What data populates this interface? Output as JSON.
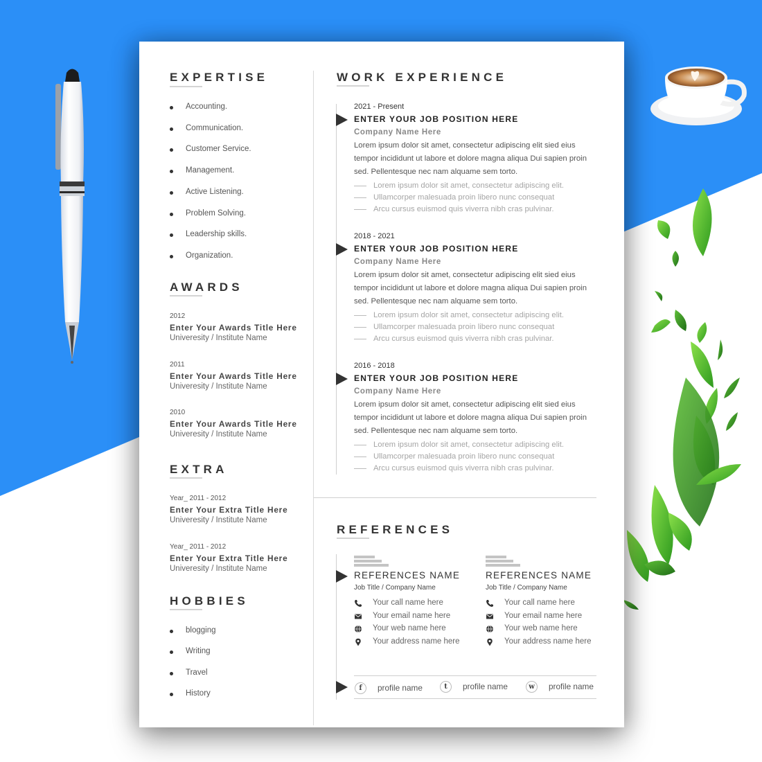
{
  "colors": {
    "background_blue": "#2b8ff7",
    "background_white": "#ffffff",
    "heading": "#333333",
    "accent_arrow": "#333333"
  },
  "decorations": {
    "pen": "white-ballpoint-pen-icon",
    "coffee": "latte-coffee-cup-icon",
    "leaves": "green-leaves-icon"
  },
  "expertise": {
    "title": "EXPERTISE",
    "items": [
      "Accounting.",
      "Communication.",
      "Customer Service.",
      "Management.",
      "Active Listening.",
      "Problem Solving.",
      "Leadership skills.",
      "Organization."
    ]
  },
  "awards": {
    "title": "AWARDS",
    "items": [
      {
        "year": "2012",
        "title": "Enter Your Awards Title Here",
        "institute": "Univeresity / Institute Name"
      },
      {
        "year": "2011",
        "title": "Enter Your Awards Title Here",
        "institute": "Univeresity / Institute Name"
      },
      {
        "year": "2010",
        "title": "Enter Your Awards Title Here",
        "institute": "Univeresity / Institute Name"
      }
    ]
  },
  "extra": {
    "title": "EXTRA",
    "items": [
      {
        "year": "Year_ 2011 - 2012",
        "title": "Enter Your Extra Title Here",
        "institute": "Univeresity / Institute Name"
      },
      {
        "year": "Year_ 2011 - 2012",
        "title": "Enter Your Extra Title Here",
        "institute": "Univeresity / Institute Name"
      }
    ]
  },
  "hobbies": {
    "title": "HOBBIES",
    "items": [
      "blogging",
      "Writing",
      "Travel",
      "History"
    ]
  },
  "work": {
    "title": "WORK EXPERIENCE",
    "jobs": [
      {
        "date": "2021 - Present",
        "position": "ENTER YOUR JOB POSITION HERE",
        "company": "Company Name Here",
        "description": "Lorem ipsum dolor sit amet, consectetur adipiscing elit sied eius tempor incididunt ut labore et dolore magna aliqua Dui sapien proin sed. Pellentesque nec nam alquame sem torto.",
        "points": [
          "Lorem ipsum dolor sit amet, consectetur adipiscing elit.",
          "Ullamcorper malesuada proin libero nunc consequat",
          "Arcu cursus euismod quis viverra nibh cras pulvinar."
        ]
      },
      {
        "date": "2018 - 2021",
        "position": "ENTER YOUR JOB POSITION HERE",
        "company": "Company Name Here",
        "description": "Lorem ipsum dolor sit amet, consectetur adipiscing elit sied eius tempor incididunt ut labore et dolore magna aliqua Dui sapien proin sed. Pellentesque nec nam alquame sem torto.",
        "points": [
          "Lorem ipsum dolor sit amet, consectetur adipiscing elit.",
          "Ullamcorper malesuada proin libero nunc consequat",
          "Arcu cursus euismod quis viverra nibh cras pulvinar."
        ]
      },
      {
        "date": "2016 - 2018",
        "position": "ENTER YOUR JOB POSITION HERE",
        "company": "Company Name Here",
        "description": "Lorem ipsum dolor sit amet, consectetur adipiscing elit sied eius tempor incididunt ut labore et dolore magna aliqua Dui sapien proin sed. Pellentesque nec nam alquame sem torto.",
        "points": [
          "Lorem ipsum dolor sit amet, consectetur adipiscing elit.",
          "Ullamcorper malesuada proin libero nunc consequat",
          "Arcu cursus euismod quis viverra nibh cras pulvinar."
        ]
      }
    ]
  },
  "references": {
    "title": "REFERENCES",
    "people": [
      {
        "name": "REFERENCES NAME",
        "job": "Job Title / Company Name",
        "call": "Your  call name here",
        "email": "Your email name here",
        "web": "Your web name here",
        "address": "Your address name here"
      },
      {
        "name": "REFERENCES NAME",
        "job": "Job Title / Company Name",
        "call": "Your  call name here",
        "email": "Your email name here",
        "web": "Your web name here",
        "address": "Your address name here"
      }
    ],
    "social": [
      {
        "icon_letter": "f",
        "icon": "facebook-icon",
        "label": "profile name"
      },
      {
        "icon_letter": "t",
        "icon": "twitter-icon",
        "label": "profile name"
      },
      {
        "icon_letter": "w",
        "icon": "website-icon",
        "label": "profile name"
      }
    ]
  }
}
